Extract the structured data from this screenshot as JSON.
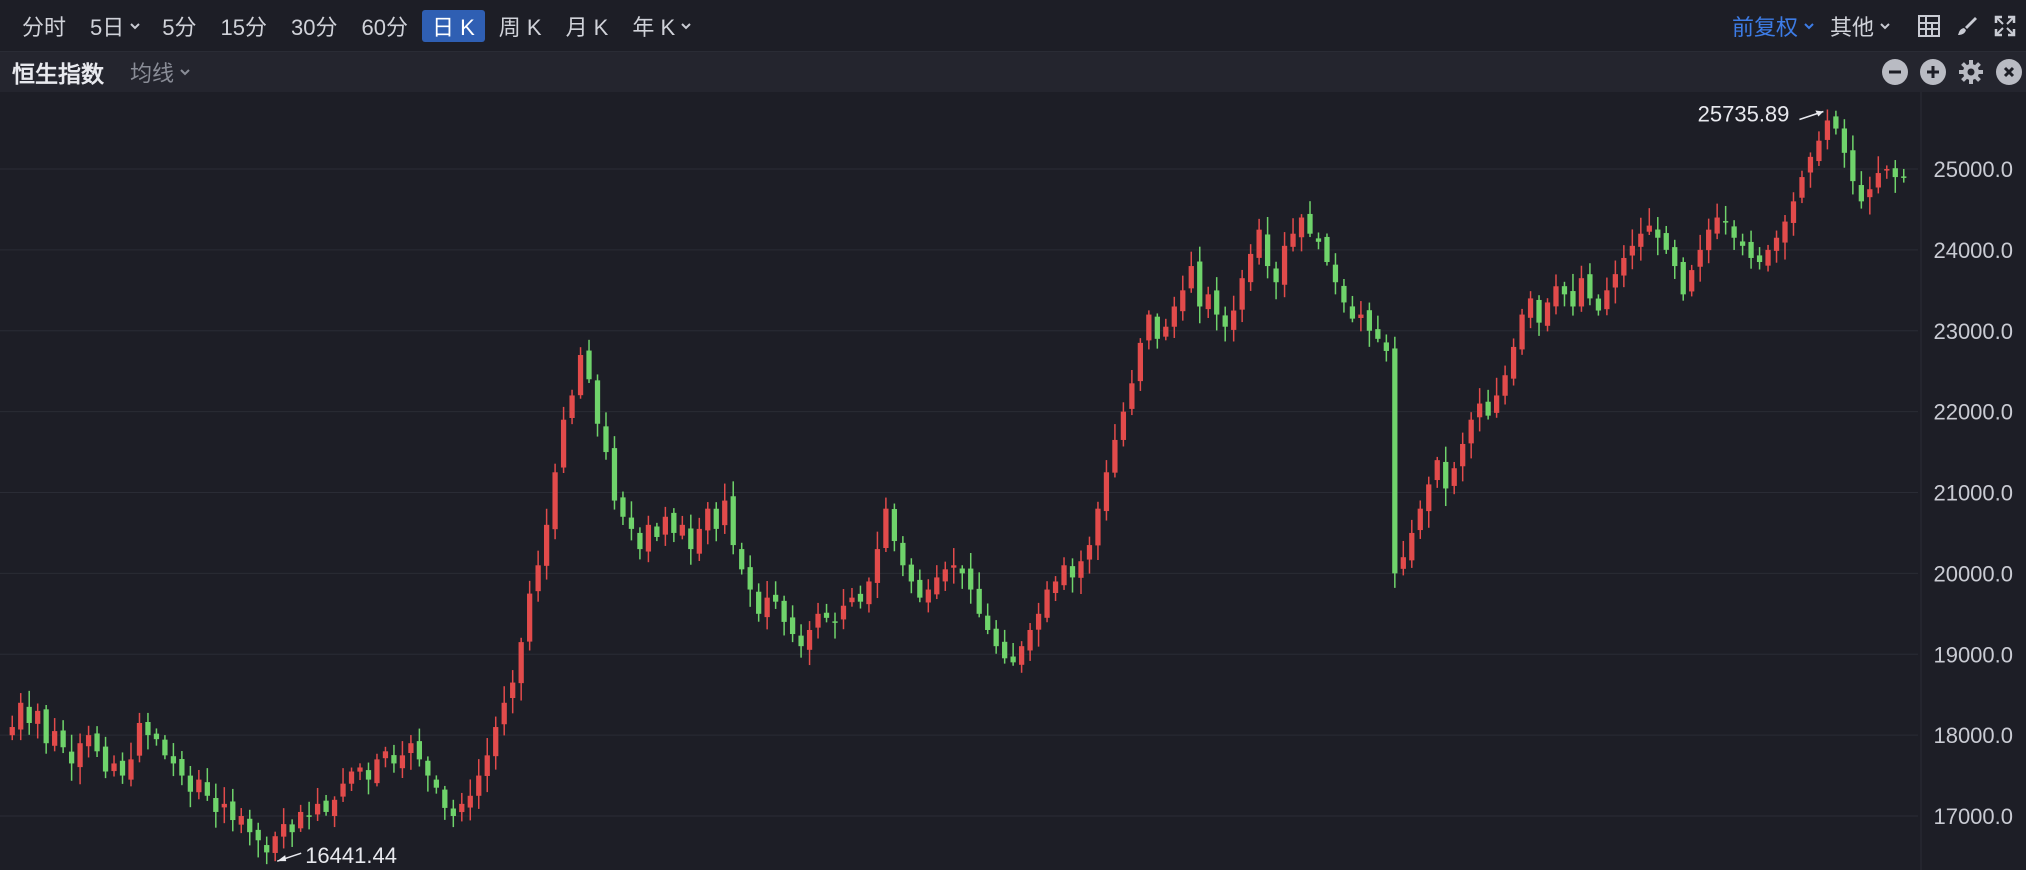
{
  "toolbar": {
    "timeframes": [
      "分时",
      "5日",
      "5分",
      "15分",
      "30分",
      "60分",
      "日 K",
      "周 K",
      "月 K",
      "年 K"
    ],
    "active": "日 K",
    "adjust_label": "前复权",
    "other_label": "其他"
  },
  "subbar": {
    "index_name": "恒生指数",
    "ma_label": "均线"
  },
  "icons": [
    "grid-icon",
    "brush-icon",
    "fullscreen-icon",
    "zoom-out-icon",
    "zoom-in-icon",
    "settings-icon",
    "close-icon"
  ],
  "colors": {
    "up": "#e24b4b",
    "down": "#6fd36b",
    "accent": "#3d7ce6",
    "background": "#1d1e26"
  },
  "chart_data": {
    "type": "candlestick",
    "ylim": [
      16441.44,
      25735.89
    ],
    "y_ticks": [
      "17000.0",
      "18000.0",
      "19000.0",
      "20000.0",
      "21000.0",
      "22000.0",
      "23000.0",
      "24000.0",
      "25000.0"
    ],
    "y_tick_values": [
      17000,
      18000,
      19000,
      20000,
      21000,
      22000,
      23000,
      24000,
      25000
    ],
    "max_label": "25735.89",
    "min_label": "16441.44",
    "closes": [
      18100,
      18400,
      18150,
      18300,
      17900,
      18050,
      17850,
      17650,
      17900,
      18000,
      17800,
      17550,
      17650,
      17500,
      17700,
      18150,
      18000,
      17950,
      17750,
      17650,
      17500,
      17300,
      17450,
      17250,
      17050,
      17150,
      16950,
      17000,
      16800,
      16700,
      16550,
      16750,
      16900,
      16800,
      17050,
      17000,
      17150,
      17050,
      17200,
      17400,
      17550,
      17600,
      17450,
      17700,
      17800,
      17650,
      17750,
      17900,
      17700,
      17500,
      17350,
      17100,
      17000,
      17150,
      17250,
      17500,
      17750,
      18100,
      18400,
      18650,
      19150,
      19750,
      20100,
      20600,
      21250,
      21900,
      22200,
      22700,
      22400,
      21850,
      21500,
      20900,
      20700,
      20550,
      20300,
      20600,
      20450,
      20700,
      20500,
      20600,
      20300,
      20550,
      20800,
      20550,
      20900,
      20350,
      20050,
      19800,
      19500,
      19700,
      19650,
      19400,
      19250,
      19100,
      19300,
      19500,
      19450,
      19400,
      19600,
      19700,
      19650,
      19900,
      20300,
      20800,
      20400,
      20100,
      19900,
      19700,
      19800,
      19950,
      20050,
      20100,
      20000,
      19800,
      19500,
      19300,
      19100,
      18950,
      18900,
      19100,
      19300,
      19500,
      19800,
      19900,
      20100,
      19950,
      20150,
      20350,
      20800,
      21250,
      21650,
      22000,
      22350,
      22850,
      23200,
      22900,
      23050,
      23300,
      23500,
      23800,
      23300,
      23450,
      23200,
      23050,
      23250,
      23650,
      23950,
      24250,
      23800,
      23600,
      24050,
      24200,
      24400,
      24200,
      24100,
      23850,
      23600,
      23350,
      23150,
      23200,
      23000,
      22900,
      22750,
      20000,
      20200,
      20500,
      20800,
      21100,
      21400,
      21050,
      21300,
      21600,
      21900,
      22100,
      21950,
      22200,
      22450,
      22800,
      23200,
      23400,
      23100,
      23350,
      23550,
      23450,
      23300,
      23650,
      23400,
      23250,
      23500,
      23700,
      23900,
      24050,
      24200,
      24300,
      24150,
      24000,
      23800,
      23450,
      23750,
      24000,
      24250,
      24400,
      24350,
      24150,
      24050,
      23900,
      23850,
      24000,
      24150,
      24350,
      24600,
      24900,
      25150,
      25350,
      25600,
      25500,
      25200,
      24850,
      24600,
      24750,
      24950,
      25000,
      24900,
      24900
    ],
    "first_open": 18000
  }
}
